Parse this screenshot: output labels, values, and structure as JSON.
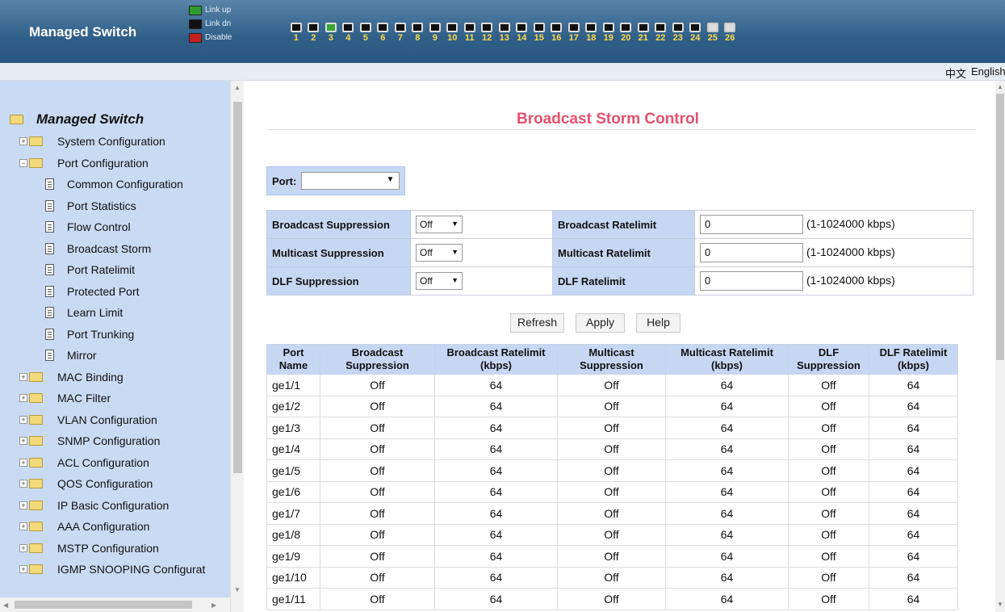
{
  "header": {
    "brand": "Managed Switch",
    "legend": {
      "link_up": "Link up",
      "link_dn": "Link dn",
      "disable": "Disable"
    }
  },
  "ports": [
    {
      "num": "1",
      "state": "down"
    },
    {
      "num": "2",
      "state": "down"
    },
    {
      "num": "3",
      "state": "up"
    },
    {
      "num": "4",
      "state": "down"
    },
    {
      "num": "5",
      "state": "down"
    },
    {
      "num": "6",
      "state": "down"
    },
    {
      "num": "7",
      "state": "down"
    },
    {
      "num": "8",
      "state": "down"
    },
    {
      "num": "9",
      "state": "down"
    },
    {
      "num": "10",
      "state": "down"
    },
    {
      "num": "11",
      "state": "down"
    },
    {
      "num": "12",
      "state": "down"
    },
    {
      "num": "13",
      "state": "down"
    },
    {
      "num": "14",
      "state": "down"
    },
    {
      "num": "15",
      "state": "down"
    },
    {
      "num": "16",
      "state": "down"
    },
    {
      "num": "17",
      "state": "down"
    },
    {
      "num": "18",
      "state": "down"
    },
    {
      "num": "19",
      "state": "down"
    },
    {
      "num": "20",
      "state": "down"
    },
    {
      "num": "21",
      "state": "down"
    },
    {
      "num": "22",
      "state": "down"
    },
    {
      "num": "23",
      "state": "down"
    },
    {
      "num": "24",
      "state": "down"
    },
    {
      "num": "25",
      "state": "fiber"
    },
    {
      "num": "26",
      "state": "fiber"
    }
  ],
  "lang": {
    "zh": "中文",
    "en": "English"
  },
  "sidebar": {
    "root": "Managed Switch",
    "items": [
      {
        "label": "System Configuration",
        "type": "folder"
      },
      {
        "label": "Port Configuration",
        "type": "folder-open"
      },
      {
        "label": "Common Configuration",
        "type": "doc"
      },
      {
        "label": "Port Statistics",
        "type": "doc"
      },
      {
        "label": "Flow Control",
        "type": "doc"
      },
      {
        "label": "Broadcast Storm",
        "type": "doc"
      },
      {
        "label": "Port Ratelimit",
        "type": "doc"
      },
      {
        "label": "Protected Port",
        "type": "doc"
      },
      {
        "label": "Learn Limit",
        "type": "doc"
      },
      {
        "label": "Port Trunking",
        "type": "doc"
      },
      {
        "label": "Mirror",
        "type": "doc"
      },
      {
        "label": "MAC Binding",
        "type": "folder"
      },
      {
        "label": "MAC Filter",
        "type": "folder"
      },
      {
        "label": "VLAN Configuration",
        "type": "folder"
      },
      {
        "label": "SNMP Configuration",
        "type": "folder"
      },
      {
        "label": "ACL Configuration",
        "type": "folder"
      },
      {
        "label": "QOS Configuration",
        "type": "folder"
      },
      {
        "label": "IP Basic Configuration",
        "type": "folder"
      },
      {
        "label": "AAA Configuration",
        "type": "folder"
      },
      {
        "label": "MSTP Configuration",
        "type": "folder"
      },
      {
        "label": "IGMP SNOOPING Configurat",
        "type": "folder"
      }
    ]
  },
  "main": {
    "title": "Broadcast Storm Control",
    "port_label": "Port:",
    "port_value": "",
    "controls": [
      {
        "label": "Broadcast Suppression",
        "value": "Off",
        "rate_label": "Broadcast Ratelimit",
        "rate": "0",
        "range": "(1-1024000 kbps)"
      },
      {
        "label": "Multicast Suppression",
        "value": "Off",
        "rate_label": "Multicast Ratelimit",
        "rate": "0",
        "range": "(1-1024000 kbps)"
      },
      {
        "label": "DLF Suppression",
        "value": "Off",
        "rate_label": "DLF Ratelimit",
        "rate": "0",
        "range": "(1-1024000 kbps)"
      }
    ],
    "buttons": {
      "refresh": "Refresh",
      "apply": "Apply",
      "help": "Help"
    },
    "table": {
      "headers": [
        "Port Name",
        "Broadcast Suppression",
        "Broadcast Ratelimit (kbps)",
        "Multicast Suppression",
        "Multicast Ratelimit (kbps)",
        "DLF Suppression",
        "DLF Ratelimit (kbps)"
      ],
      "rows": [
        [
          "ge1/1",
          "Off",
          "64",
          "Off",
          "64",
          "Off",
          "64"
        ],
        [
          "ge1/2",
          "Off",
          "64",
          "Off",
          "64",
          "Off",
          "64"
        ],
        [
          "ge1/3",
          "Off",
          "64",
          "Off",
          "64",
          "Off",
          "64"
        ],
        [
          "ge1/4",
          "Off",
          "64",
          "Off",
          "64",
          "Off",
          "64"
        ],
        [
          "ge1/5",
          "Off",
          "64",
          "Off",
          "64",
          "Off",
          "64"
        ],
        [
          "ge1/6",
          "Off",
          "64",
          "Off",
          "64",
          "Off",
          "64"
        ],
        [
          "ge1/7",
          "Off",
          "64",
          "Off",
          "64",
          "Off",
          "64"
        ],
        [
          "ge1/8",
          "Off",
          "64",
          "Off",
          "64",
          "Off",
          "64"
        ],
        [
          "ge1/9",
          "Off",
          "64",
          "Off",
          "64",
          "Off",
          "64"
        ],
        [
          "ge1/10",
          "Off",
          "64",
          "Off",
          "64",
          "Off",
          "64"
        ],
        [
          "ge1/11",
          "Off",
          "64",
          "Off",
          "64",
          "Off",
          "64"
        ]
      ]
    }
  }
}
